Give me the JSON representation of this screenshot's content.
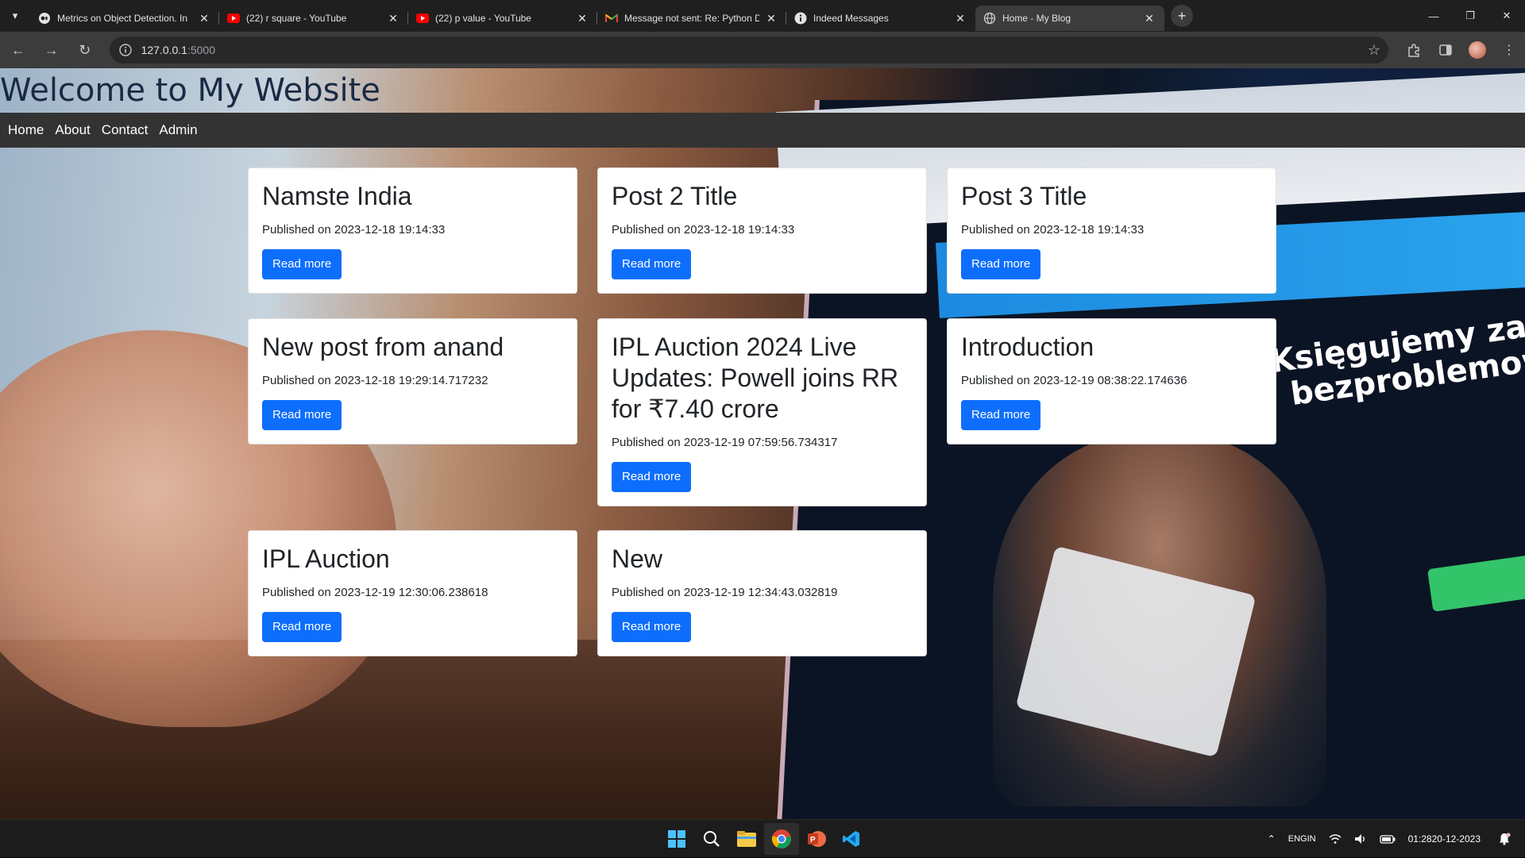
{
  "browser": {
    "tabs": [
      {
        "title": "Metrics on Object Detection. In",
        "icon": "medium-icon",
        "active": false
      },
      {
        "title": "(22) r square - YouTube",
        "icon": "youtube-icon",
        "active": false
      },
      {
        "title": "(22) p value - YouTube",
        "icon": "youtube-icon",
        "active": false
      },
      {
        "title": "Message not sent: Re: Python D",
        "icon": "gmail-icon",
        "active": false
      },
      {
        "title": "Indeed Messages",
        "icon": "info-icon",
        "active": false
      },
      {
        "title": "Home - My Blog",
        "icon": "globe-icon",
        "active": true
      }
    ],
    "new_tab": "+",
    "window_controls": {
      "minimize": "—",
      "restore": "❐",
      "close": "✕"
    },
    "address": {
      "host": "127.0.0.1",
      "port": ":5000"
    },
    "nav": {
      "back": "←",
      "forward": "→",
      "reload": "↻"
    },
    "star": "☆"
  },
  "site": {
    "title": "Welcome to My Website",
    "nav": [
      "Home",
      "About",
      "Contact",
      "Admin"
    ]
  },
  "background_text": {
    "headline_1": "Księgujemy za Ciebie",
    "headline_2": "bezproblemowo"
  },
  "posts": [
    {
      "title": "Namste India",
      "published": "Published on 2023-12-18 19:14:33",
      "button": "Read more"
    },
    {
      "title": "Post 2 Title",
      "published": "Published on 2023-12-18 19:14:33",
      "button": "Read more"
    },
    {
      "title": "Post 3 Title",
      "published": "Published on 2023-12-18 19:14:33",
      "button": "Read more"
    },
    {
      "title": "New post from anand",
      "published": "Published on 2023-12-18 19:29:14.717232",
      "button": "Read more"
    },
    {
      "title": "IPL Auction 2024 Live Updates: Powell joins RR for ₹7.40 crore",
      "published": "Published on 2023-12-19 07:59:56.734317",
      "button": "Read more"
    },
    {
      "title": "Introduction",
      "published": "Published on 2023-12-19 08:38:22.174636",
      "button": "Read more"
    },
    {
      "title": "IPL Auction",
      "published": "Published on 2023-12-19 12:30:06.238618",
      "button": "Read more"
    },
    {
      "title": "New",
      "published": "Published on 2023-12-19 12:34:43.032819",
      "button": "Read more"
    }
  ],
  "taskbar": {
    "apps": [
      "windows-start-icon",
      "search-icon",
      "file-explorer-icon",
      "chrome-icon",
      "powerpoint-icon",
      "vscode-icon"
    ],
    "lang_1": "ENG",
    "lang_2": "IN",
    "time": "01:28",
    "date": "20-12-2023"
  },
  "colors": {
    "primary_button": "#0d6efd",
    "nav_bar": "#333333",
    "site_title": "#1b2a44"
  }
}
